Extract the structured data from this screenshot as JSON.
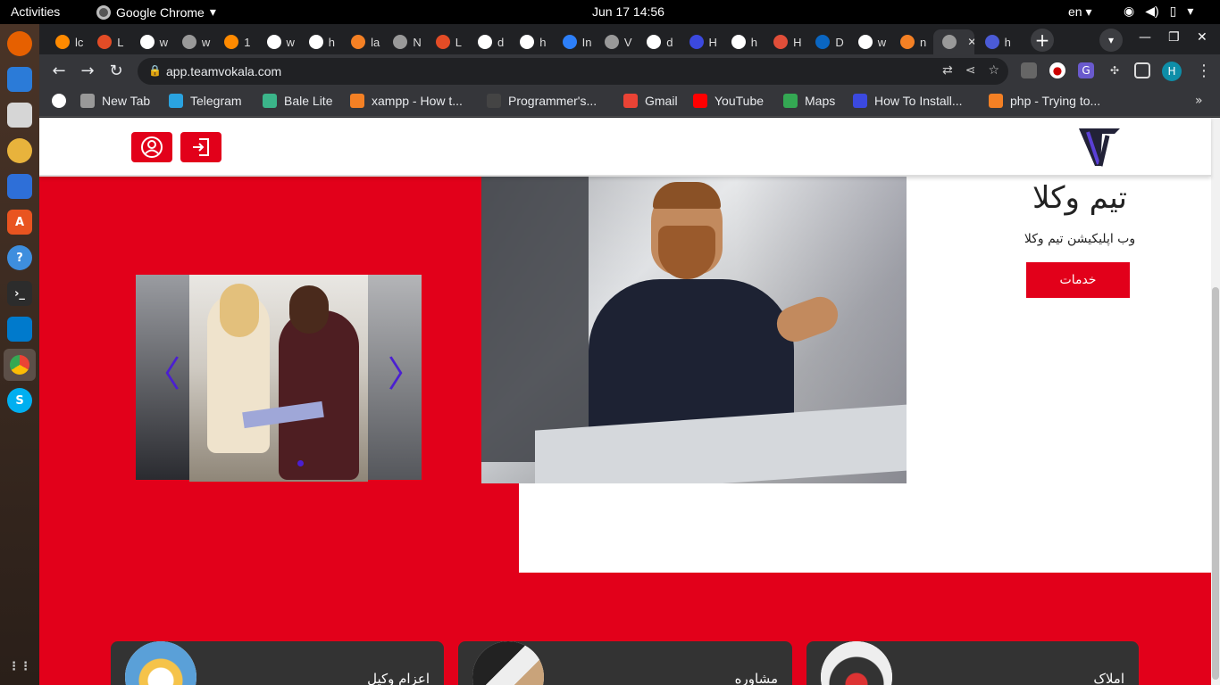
{
  "topbar": {
    "activities": "Activities",
    "app_name": "Google Chrome",
    "clock": "Jun 17  14:56",
    "lang": "en"
  },
  "tabs": [
    {
      "label": "lc",
      "color": "#ff8a00"
    },
    {
      "label": "L",
      "color": "#e34c26"
    },
    {
      "label": "w",
      "color": "#ffffff"
    },
    {
      "label": "w",
      "color": "#999999"
    },
    {
      "label": "1",
      "color": "#ff8a00"
    },
    {
      "label": "w",
      "color": "#ffffff"
    },
    {
      "label": "h",
      "color": "#ffffff"
    },
    {
      "label": "la",
      "color": "#f48024"
    },
    {
      "label": "N",
      "color": "#999999"
    },
    {
      "label": "L",
      "color": "#e34c26"
    },
    {
      "label": "d",
      "color": "#ffffff"
    },
    {
      "label": "h",
      "color": "#ffffff"
    },
    {
      "label": "In",
      "color": "#2d7ff9"
    },
    {
      "label": "V",
      "color": "#999999"
    },
    {
      "label": "d",
      "color": "#ffffff"
    },
    {
      "label": "H",
      "color": "#3b49df"
    },
    {
      "label": "h",
      "color": "#ffffff"
    },
    {
      "label": "H",
      "color": "#e04e39"
    },
    {
      "label": "D",
      "color": "#0a66c2"
    },
    {
      "label": "w",
      "color": "#ffffff"
    },
    {
      "label": "n",
      "color": "#f48024"
    },
    {
      "label": "",
      "color": "#999999"
    },
    {
      "label": "h",
      "color": "#4b5bd6"
    }
  ],
  "omnibox": {
    "url": "app.teamvokala.com"
  },
  "profile_initial": "H",
  "bookmarks": [
    {
      "label": "New Tab",
      "color": "#999999"
    },
    {
      "label": "Telegram",
      "color": "#2aa3e0"
    },
    {
      "label": "Bale Lite",
      "color": "#3bb58a"
    },
    {
      "label": "xampp - How t...",
      "color": "#f48024"
    },
    {
      "label": "Programmer's...",
      "color": "#444444"
    },
    {
      "label": "Gmail",
      "color": "#ea4335"
    },
    {
      "label": "YouTube",
      "color": "#ff0000"
    },
    {
      "label": "Maps",
      "color": "#34a853"
    },
    {
      "label": "How To Install...",
      "color": "#3b49df"
    },
    {
      "label": "php - Trying to...",
      "color": "#f48024"
    }
  ],
  "page": {
    "hero_title": "تیم وکلا",
    "hero_subtitle": "وب اپلیکیشن تیم وکلا",
    "services_button": "خدمات",
    "cards": [
      {
        "label": "املاک"
      },
      {
        "label": "مشاوره"
      },
      {
        "label": "اعزام وکیل"
      }
    ],
    "brand_color": "#e2001a",
    "accent_color": "#4b1fd1"
  }
}
